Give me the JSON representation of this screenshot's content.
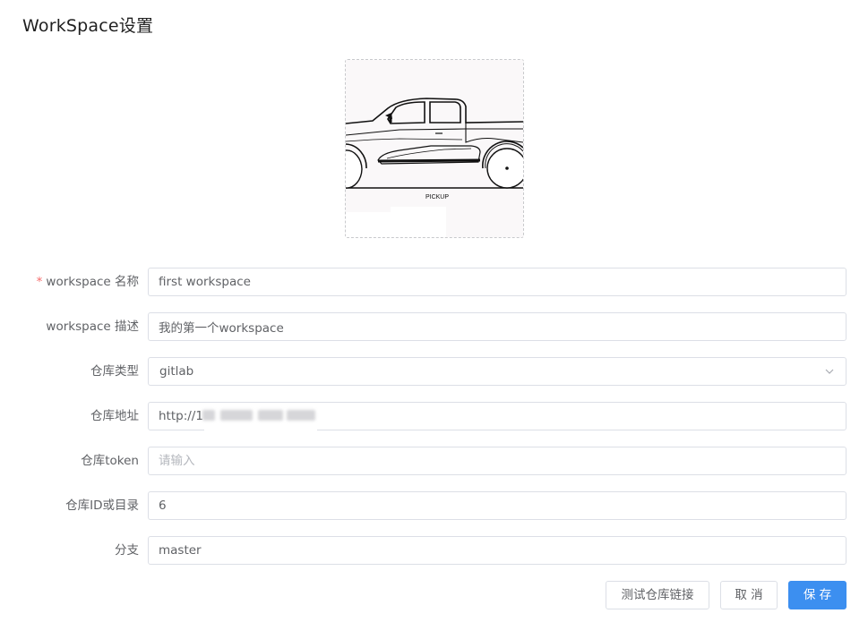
{
  "page": {
    "title": "WorkSpace设置"
  },
  "avatar": {
    "caption": "PICKUP",
    "icon": "pickup-truck-image"
  },
  "form": {
    "name": {
      "label": "workspace 名称",
      "required": true,
      "required_mark": "*",
      "value": "first workspace"
    },
    "description": {
      "label": "workspace 描述",
      "value": "我的第一个workspace"
    },
    "repo_type": {
      "label": "仓库类型",
      "value": "gitlab",
      "icon": "chevron-down-icon"
    },
    "repo_url": {
      "label": "仓库地址",
      "value": "http://1"
    },
    "repo_token": {
      "label": "仓库token",
      "value": "",
      "placeholder": "请输入"
    },
    "repo_id": {
      "label": "仓库ID或目录",
      "value": "6"
    },
    "branch": {
      "label": "分支",
      "value": "master"
    }
  },
  "actions": {
    "test_connection": "测试仓库链接",
    "cancel": "取 消",
    "save": "保 存"
  },
  "colors": {
    "primary": "#3c8ff0",
    "required": "#f56c6c",
    "border": "#dcdfe6",
    "label": "#606266"
  }
}
